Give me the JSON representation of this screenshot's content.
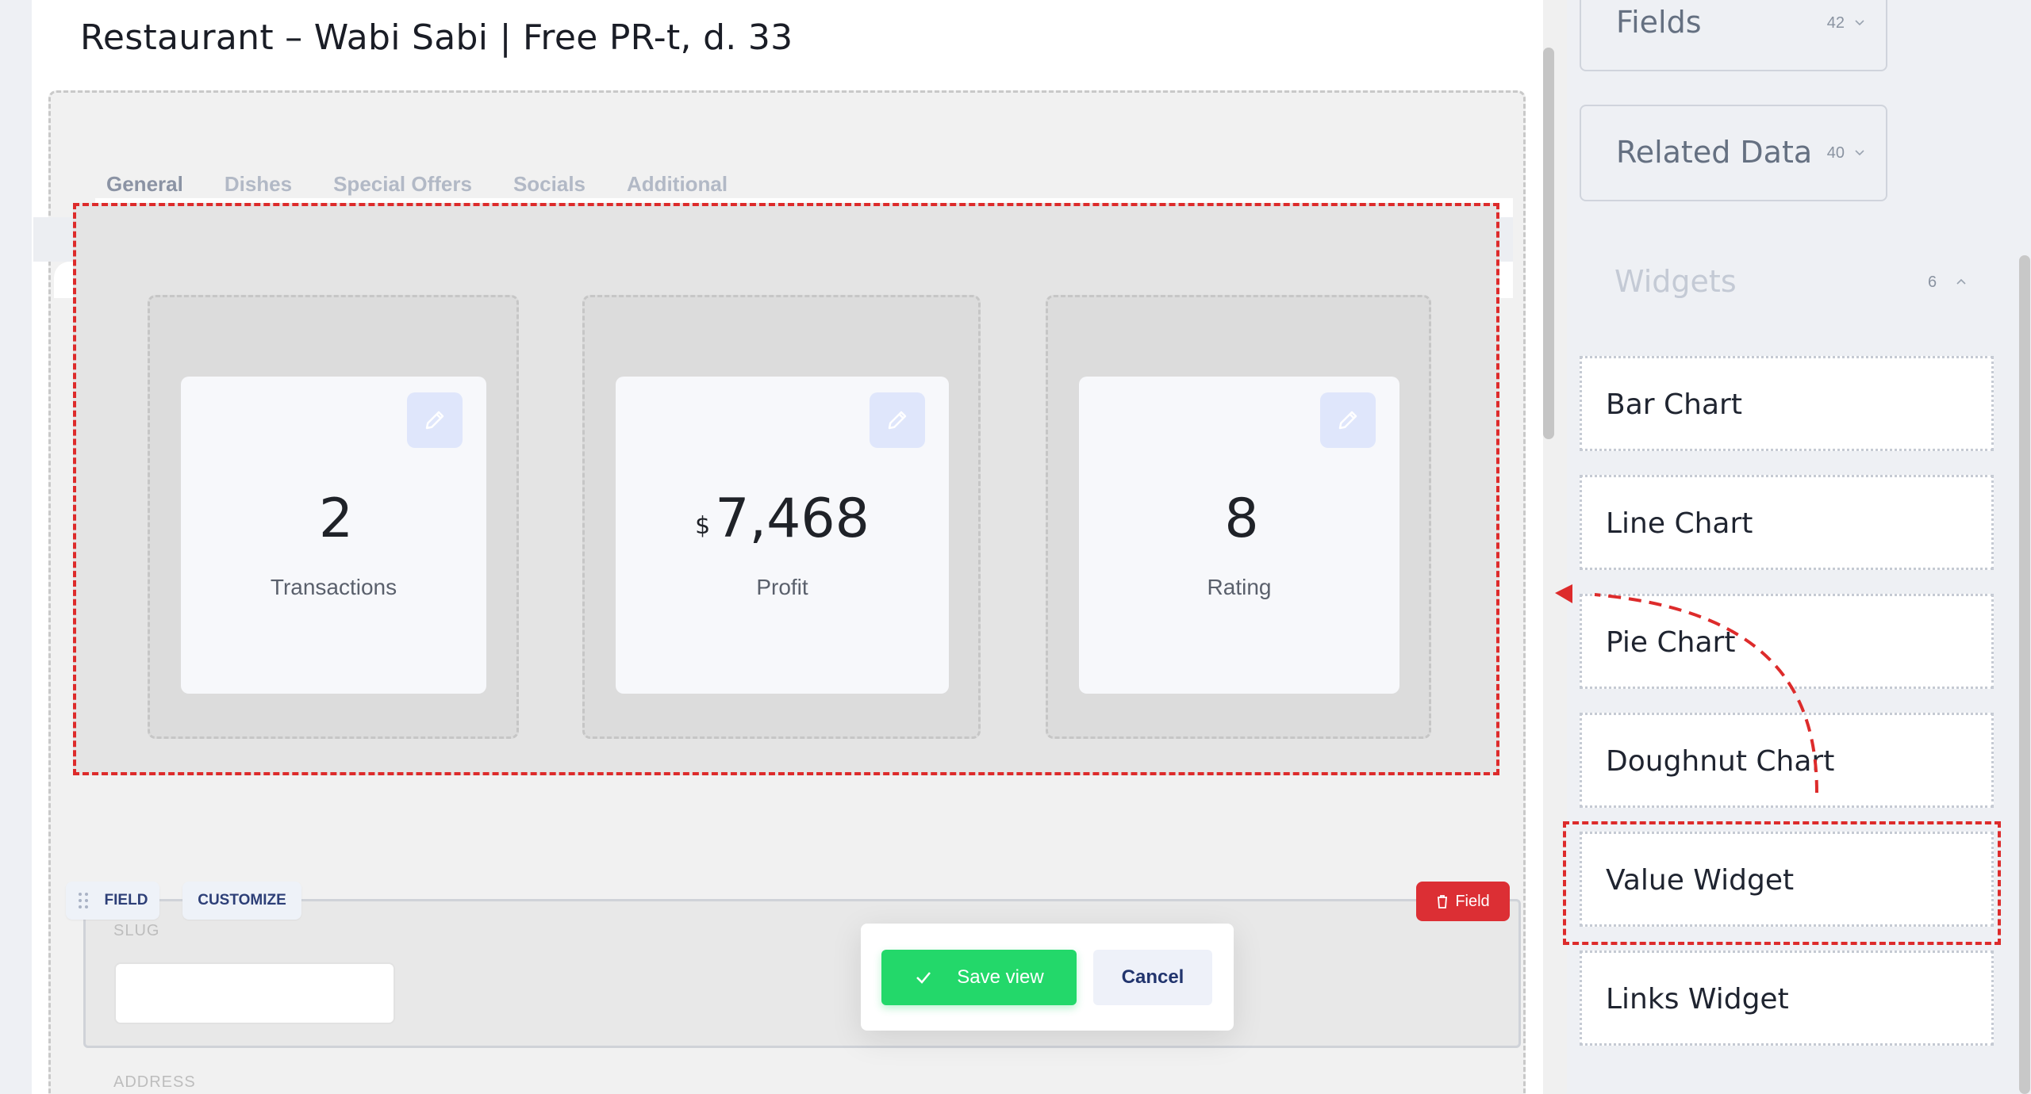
{
  "page": {
    "title": "Restaurant – Wabi Sabi | Free PR-t, d. 33"
  },
  "tabs": [
    {
      "label": "General",
      "active": true
    },
    {
      "label": "Dishes",
      "active": false
    },
    {
      "label": "Special Offers",
      "active": false
    },
    {
      "label": "Socials",
      "active": false
    },
    {
      "label": "Additional",
      "active": false
    }
  ],
  "value_widgets": [
    {
      "value": "2",
      "currency": "",
      "label": "Transactions"
    },
    {
      "value": "7,468",
      "currency": "$",
      "label": "Profit"
    },
    {
      "value": "8",
      "currency": "",
      "label": "Rating"
    }
  ],
  "field_block": {
    "field_chip": "FIELD",
    "customize_chip": "CUSTOMIZE",
    "delete_label": "Field",
    "slug_label": "SLUG",
    "slug_value": "",
    "address_label": "ADDRESS"
  },
  "save_toolbar": {
    "save_label": "Save view",
    "cancel_label": "Cancel"
  },
  "right_panel": {
    "fields": {
      "title": "Fields",
      "count": "42"
    },
    "related_data": {
      "title": "Related Data",
      "count": "40"
    },
    "widgets": {
      "title": "Widgets",
      "count": "6",
      "items": [
        "Bar Chart",
        "Line Chart",
        "Pie Chart",
        "Doughnut Chart",
        "Value Widget",
        "Links Widget"
      ]
    }
  },
  "colors": {
    "accent_blue": "#2b5cc7",
    "drop_outline_red": "#dd2b2b",
    "save_green": "#23d86a",
    "delete_red": "#dc2f34"
  }
}
